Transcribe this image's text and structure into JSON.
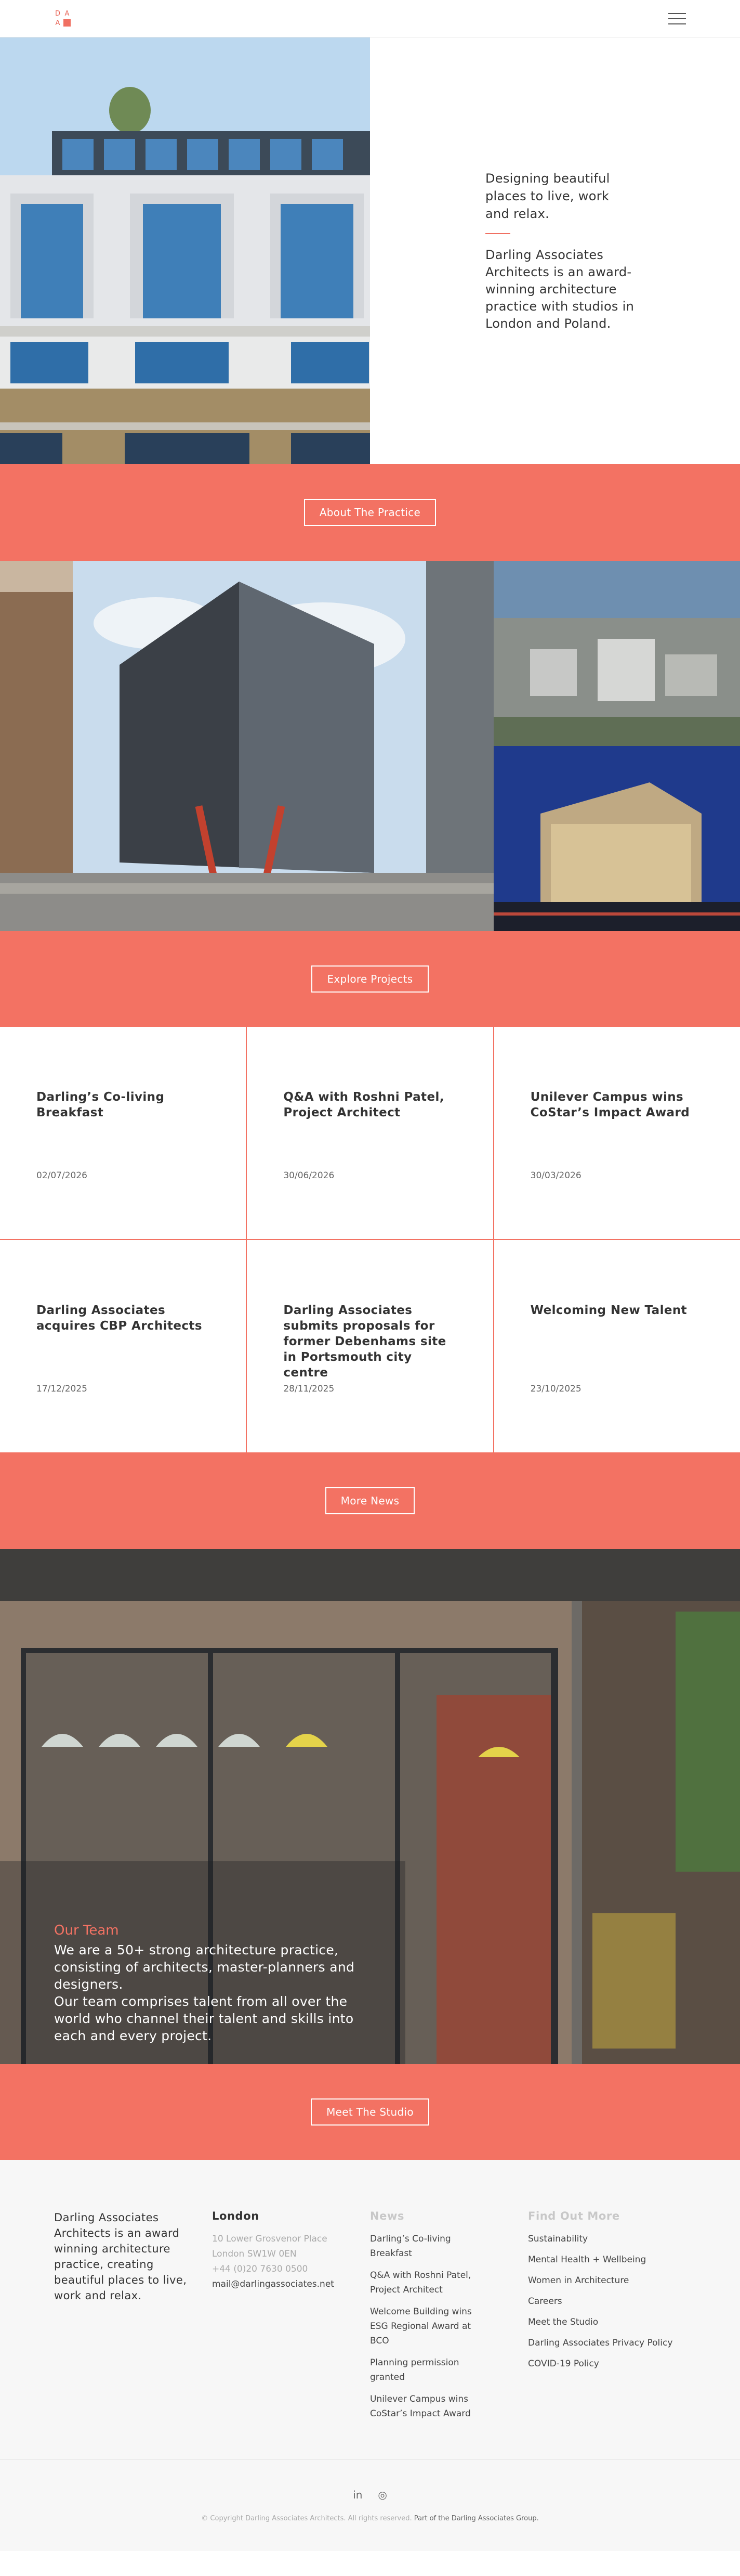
{
  "header": {
    "logo_letters": [
      "D",
      "A",
      "A"
    ],
    "menu_icon": "hamburger-menu-icon"
  },
  "hero": {
    "tagline": "Designing beautiful places to live, work and relax.",
    "description": "Darling Associates Architects is an award-winning architecture practice with studios in London and Poland."
  },
  "buttons": {
    "about": "About The Practice",
    "projects": "Explore Projects",
    "news": "More News",
    "studio": "Meet The Studio"
  },
  "news": [
    {
      "title": "Darling’s Co-living Breakfast",
      "date": "02/07/2026"
    },
    {
      "title": "Q&A with Roshni Patel, Project Architect",
      "date": "30/06/2026"
    },
    {
      "title": "Unilever Campus wins CoStar’s Impact Award",
      "date": "30/03/2026"
    },
    {
      "title": "Darling Associates acquires CBP Architects",
      "date": "17/12/2025"
    },
    {
      "title": "Darling Associates submits proposals for former Debenhams site in Portsmouth city centre",
      "date": "28/11/2025"
    },
    {
      "title": "Welcoming New Talent",
      "date": "23/10/2025"
    }
  ],
  "team": {
    "label": "Our Team",
    "line1": "We are a 50+ strong architecture practice, consisting of architects, master-planners and designers.",
    "line2": "Our team comprises talent from all over the world who channel their talent and skills into each and every project."
  },
  "footer": {
    "about": "Darling Associates Architects is an award winning architecture practice, creating beautiful places to live, work and relax.",
    "london": {
      "heading": "London",
      "address1": "10 Lower Grosvenor Place",
      "address2": "London SW1W 0EN",
      "phone": "+44 (0)20 7630 0500",
      "email": "mail@darlingassociates.net"
    },
    "news": {
      "heading": "News",
      "items": [
        "Darling’s Co-living Breakfast",
        "Q&A with Roshni Patel, Project Architect",
        "Welcome Building wins ESG Regional Award at BCO",
        "Planning permission granted",
        "Unilever Campus wins CoStar’s Impact Award"
      ]
    },
    "more": {
      "heading": "Find Out More",
      "items": [
        "Sustainability",
        "Mental Health + Wellbeing",
        "Women in Architecture",
        "Careers",
        "Meet the Studio",
        "Darling Associates Privacy Policy",
        "COVID-19 Policy"
      ]
    }
  },
  "subfooter": {
    "social_linkedin": "in",
    "social_instagram": "◎",
    "copyright": "© Copyright Darling Associates Architects. All rights reserved.",
    "group": "Part of the Darling Associates Group."
  },
  "colors": {
    "accent": "#f37263",
    "text": "#333333",
    "footer_bg": "#f7f7f7"
  }
}
